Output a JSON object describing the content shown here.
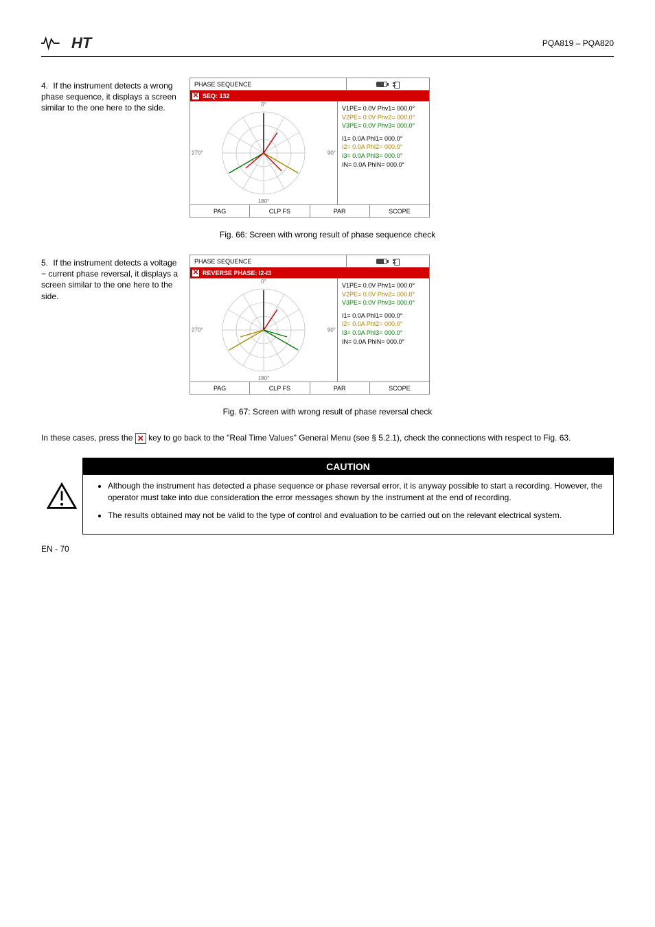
{
  "header": {
    "doc_title": "PQA819 – PQA820"
  },
  "step4": {
    "num": "4.",
    "text": "If the instrument detects a wrong phase sequence, it displays a screen similar to the one here to the side."
  },
  "step5": {
    "num": "5.",
    "text": "If the instrument detects a voltage − current phase reversal, it displays a screen similar to the one here to the side."
  },
  "fig66_caption": "Fig. 66: Screen with wrong result of phase sequence check",
  "fig67_caption": "Fig. 67: Screen with wrong result of phase reversal check",
  "para1_before_icon": "In these cases, press the ",
  "para1_after_icon": " key to go back to the \"Real Time Values\" General Menu (see § 5.2.1), check the connections with respect to Fig. 63.",
  "caution": {
    "title": "CAUTION",
    "items": [
      "Although the instrument has detected a phase sequence or phase reversal error, it is anyway possible to start a recording. However, the operator must take into due consideration the error messages shown by the instrument at the end of recording.",
      "The results obtained may not be valid to the type of control and evaluation to be carried out on the relevant electrical system."
    ]
  },
  "device66": {
    "title": "PHASE SEQUENCE",
    "redbar": "SEQ: 132",
    "footer": [
      "PAG",
      "CLP FS",
      "PAR",
      "SCOPE"
    ],
    "deg_top": "0°",
    "deg_right": "90°",
    "deg_bottom": "180°",
    "deg_left": "270°",
    "readout": {
      "VL1": "V1PE=  0.0V   Phv1=  000.0°",
      "VL2": "V2PE=  0.0V   Phv2=  000.0°",
      "VL3": "V3PE=  0.0V   Phv3=  000.0°",
      "I1": "I1=     0.0A   PhI1=  000.0°",
      "I2": "I2=     0.0A   PhI2=  000.0°",
      "I3": "I3=     0.0A   PhI3=  000.0°",
      "IN": "IN=     0.0A   PhIN=  000.0°"
    }
  },
  "device67": {
    "title": "PHASE SEQUENCE",
    "redbar": "REVERSE PHASE: I2-I3",
    "footer": [
      "PAG",
      "CLP FS",
      "PAR",
      "SCOPE"
    ],
    "deg_top": "0°",
    "deg_right": "90°",
    "deg_bottom": "180°",
    "deg_left": "270°",
    "readout": {
      "VL1": "V1PE=  0.0V   Phv1=  000.0°",
      "VL2": "V2PE=  0.0V   Phv2=  000.0°",
      "VL3": "V3PE=  0.0V   Phv3=  000.0°",
      "I1": "I1=     0.0A   PhI1=  000.0°",
      "I2": "I2=     0.0A   PhI2=  000.0°",
      "I3": "I3=     0.0A   PhI3=  000.0°",
      "IN": "IN=     0.0A   PhIN=  000.0°"
    }
  },
  "chart_data": [
    {
      "type": "polar",
      "title": "Phasor diagram SEQ:132",
      "angles_deg": {
        "V1": 0,
        "V2": 240,
        "V3": 120,
        "I1": 30,
        "I2": 200,
        "I3": 140
      },
      "magnitudes": {
        "V1": 1.0,
        "V2": 1.0,
        "V3": 1.0,
        "I1": 0.6,
        "I2": 0.6,
        "I3": 0.6
      },
      "tick_angles": [
        0,
        30,
        60,
        90,
        120,
        150,
        180,
        210,
        240,
        270,
        300,
        330
      ],
      "radial_rings": [
        0.33,
        0.66,
        1.0
      ]
    },
    {
      "type": "polar",
      "title": "Phasor diagram REVERSE I2-I3",
      "angles_deg": {
        "V1": 0,
        "V2": 120,
        "V3": 240,
        "I1": 30,
        "I2": 260,
        "I3": 140
      },
      "magnitudes": {
        "V1": 1.0,
        "V2": 1.0,
        "V3": 1.0,
        "I1": 0.6,
        "I2": 0.6,
        "I3": 0.6
      },
      "tick_angles": [
        0,
        30,
        60,
        90,
        120,
        150,
        180,
        210,
        240,
        270,
        300,
        330
      ],
      "radial_rings": [
        0.33,
        0.66,
        1.0
      ]
    }
  ],
  "footer": {
    "left": "EN - 70",
    "right": ""
  }
}
